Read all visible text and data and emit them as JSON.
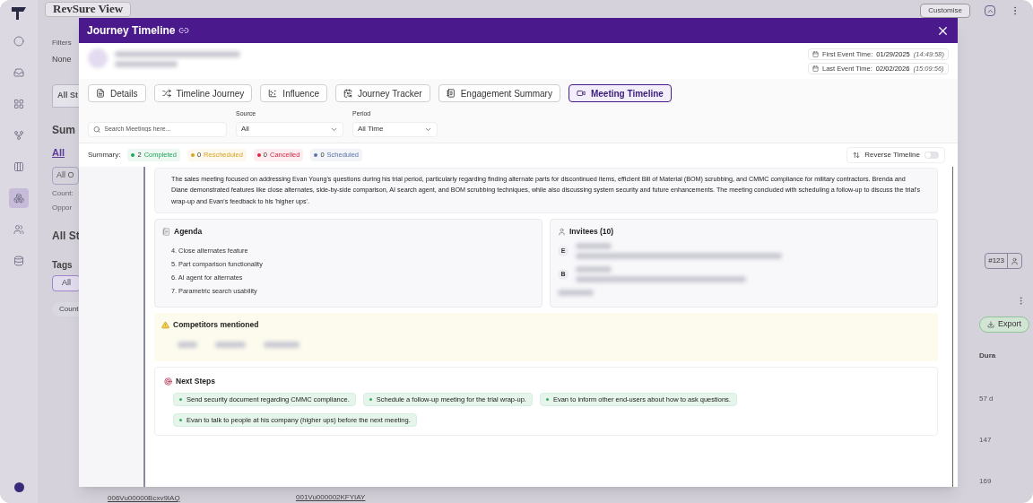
{
  "background": {
    "view_title": "RevSure View",
    "customise": "Customise",
    "filters_label": "Filters",
    "filters_value": "None",
    "left_texts": [
      {
        "kind": "tab",
        "text": "All St"
      },
      {
        "kind": "heading",
        "text": "Sum"
      },
      {
        "kind": "link",
        "text": "All"
      },
      {
        "kind": "chip",
        "text": "All O"
      },
      {
        "kind": "small",
        "text": "Count:"
      },
      {
        "kind": "small",
        "text": "Oppor"
      },
      {
        "kind": "heading",
        "text": "All St"
      },
      {
        "kind": "label",
        "text": "Tags"
      },
      {
        "kind": "tag",
        "text": "All"
      },
      {
        "kind": "pill",
        "text": "Count:"
      }
    ],
    "export": "Export",
    "column_header": "Dura",
    "durations": [
      "57 d",
      "147",
      "169"
    ],
    "toggle_label": "#123",
    "ids": [
      "006Vu00000Bcxv9IAQ",
      "001Vu000002KFYIAY"
    ]
  },
  "modal": {
    "title": "Journey Timeline",
    "first_event": {
      "label": "First Event Time:",
      "date": "01/29/2025",
      "time": "(14:49:58)"
    },
    "last_event": {
      "label": "Last Event Time:",
      "date": "02/02/2026",
      "time": "(15:09:56)"
    },
    "tabs": [
      {
        "label": "Details",
        "selected": false
      },
      {
        "label": "Timeline Journey",
        "selected": false
      },
      {
        "label": "Influence",
        "selected": false
      },
      {
        "label": "Journey Tracker",
        "selected": false
      },
      {
        "label": "Engagement Summary",
        "selected": false
      },
      {
        "label": "Meeting Timeline",
        "selected": true
      }
    ],
    "search": {
      "placeholder": "Search Meetings here..."
    },
    "source": {
      "label": "Source",
      "value": "All"
    },
    "period": {
      "label": "Period",
      "value": "All Time"
    },
    "summary": {
      "label": "Summary:",
      "items": [
        {
          "count": "2",
          "label": "Completed",
          "color": "#22a55a"
        },
        {
          "count": "0",
          "label": "Rescheduled",
          "color": "#d9a520"
        },
        {
          "count": "0",
          "label": "Cancelled",
          "color": "#dc2640"
        },
        {
          "count": "0",
          "label": "Scheduled",
          "color": "#5a74a8"
        }
      ]
    },
    "reverse_timeline": {
      "label": "Reverse Timeline",
      "on": false
    },
    "meeting_summary": "The sales meeting focused on addressing Evan Young's questions during his trial period, particularly regarding finding alternate parts for discontinued items, efficient Bill of Material (BOM) scrubbing, and CMMC compliance for military contractors. Brenda and Diane demonstrated features like close alternates, side-by-side comparison, AI search agent, and BOM scrubbing techniques, while also discussing system security and future enhancements. The meeting concluded with scheduling a follow-up to discuss the trial's wrap-up and Evan's feedback to his 'higher ups'.",
    "agenda": {
      "title": "Agenda",
      "items": [
        "4. Close alternates feature",
        "5. Part comparison functionality",
        "6. AI agent for alternates",
        "7. Parametric search usability"
      ]
    },
    "invitees": {
      "title": "Invitees (10)",
      "initials": [
        "E",
        "B"
      ]
    },
    "competitors": {
      "title": "Competitors mentioned"
    },
    "next_steps": {
      "title": "Next Steps",
      "items": [
        "Send security document regarding CMMC compliance.",
        "Schedule a follow-up meeting for the trial wrap-up.",
        "Evan to inform other end-users about how to ask questions.",
        "Evan to talk to people at his company (higher ups) before the next meeting."
      ]
    }
  }
}
